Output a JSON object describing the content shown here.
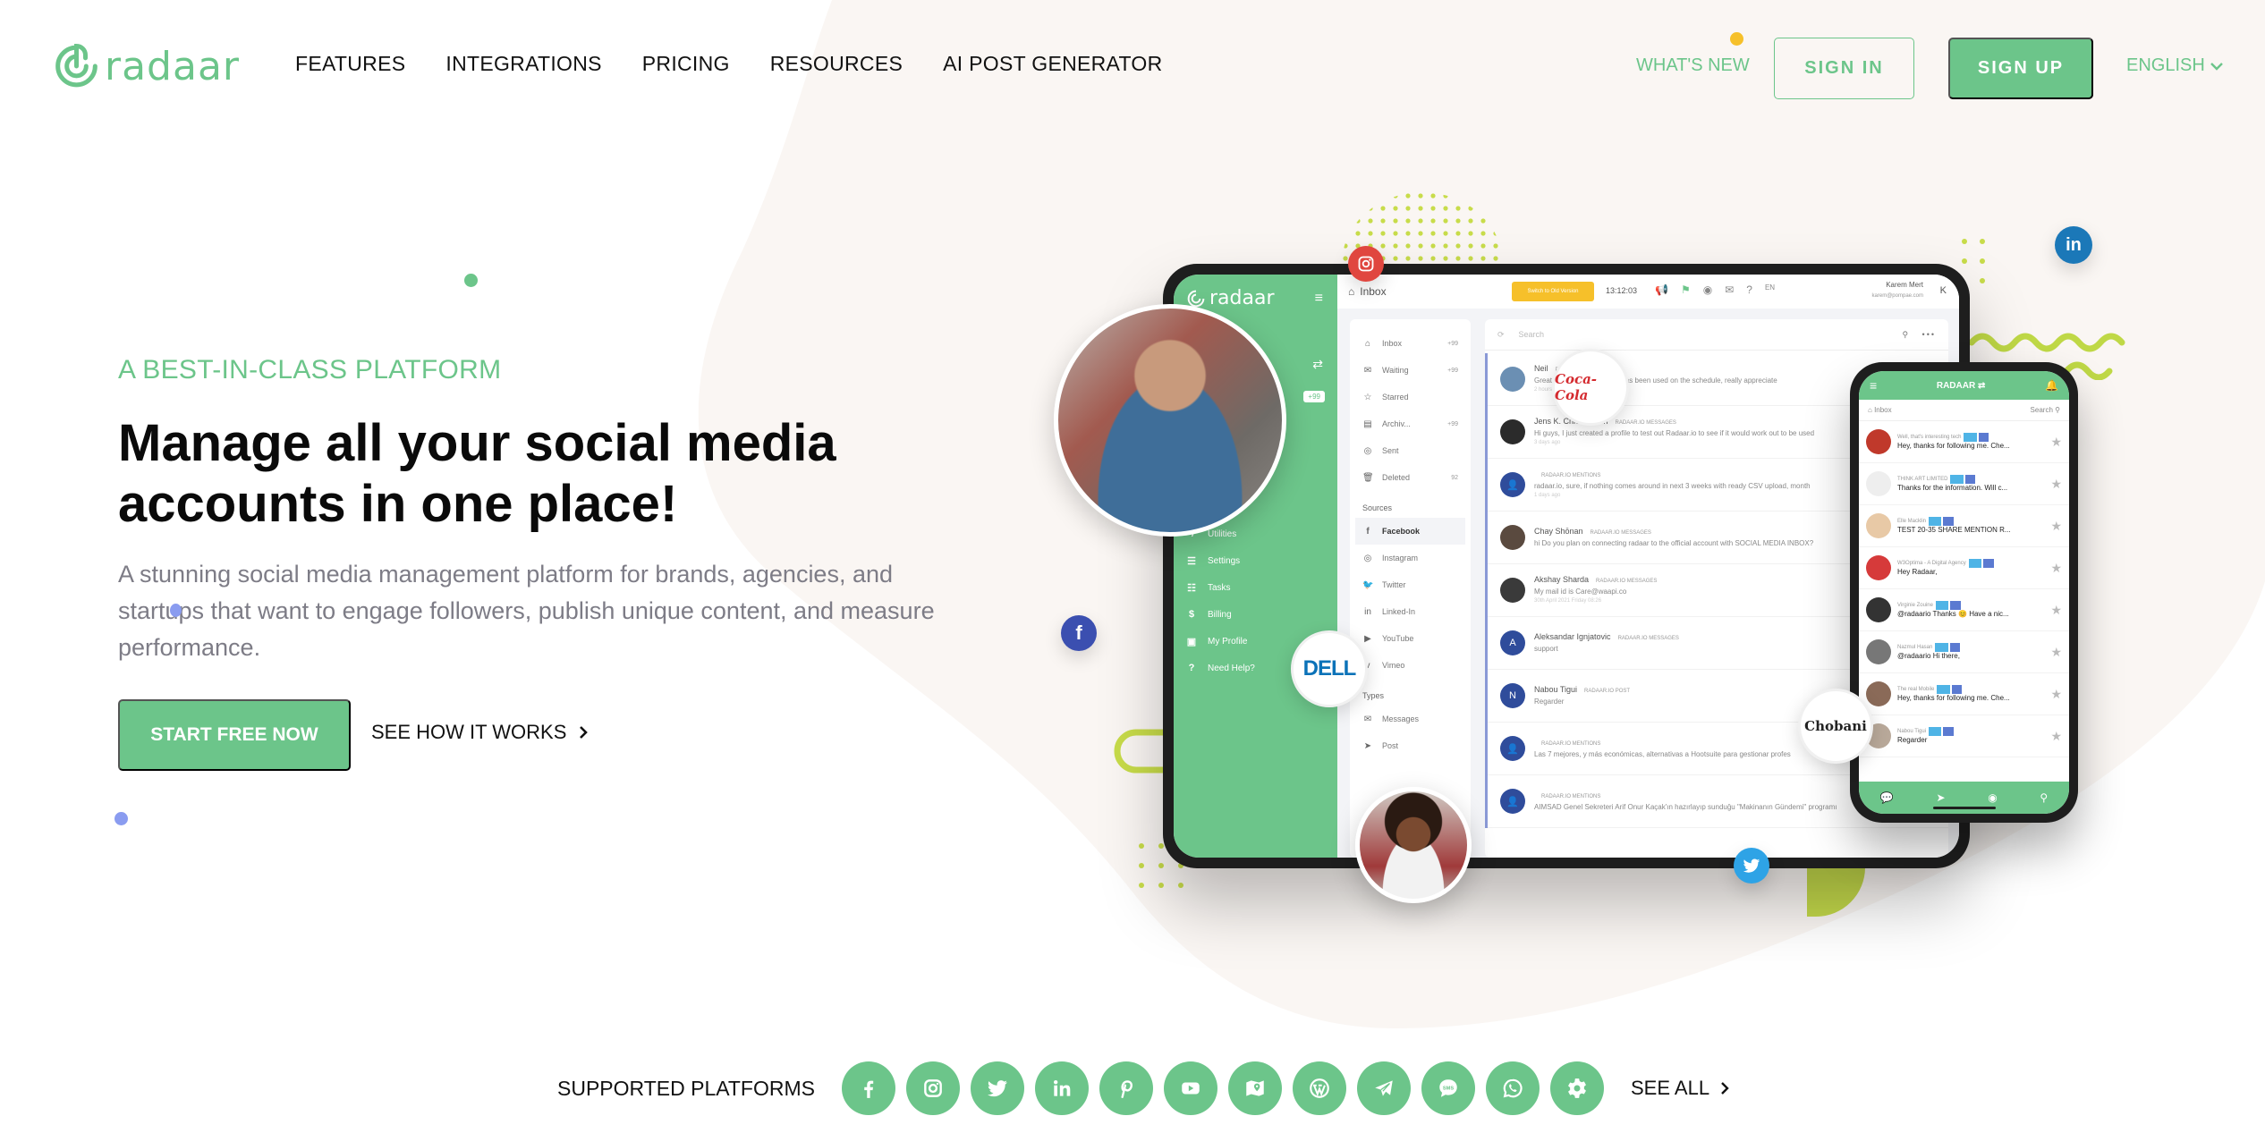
{
  "brand": {
    "name": "radaar",
    "accent": "#6cc58a",
    "notification_dot": "#f6c02a"
  },
  "nav": {
    "items": [
      "FEATURES",
      "INTEGRATIONS",
      "PRICING",
      "RESOURCES",
      "AI POST GENERATOR"
    ],
    "whats_new": "WHAT'S NEW",
    "sign_in": "SIGN IN",
    "sign_up": "SIGN UP",
    "language": "ENGLISH"
  },
  "hero": {
    "tagline": "A BEST-IN-CLASS PLATFORM",
    "headline_line1": "Manage all your social media",
    "headline_line2": "accounts in one place!",
    "subtext": "A stunning social media management platform for brands, agencies, and startups that want to engage followers, publish unique content, and measure performance.",
    "cta_primary": "START FREE NOW",
    "cta_secondary": "SEE HOW IT WORKS"
  },
  "mockup": {
    "app_logo": "radaar",
    "sidebar_badge": "+99",
    "sidebar_items": [
      {
        "icon": "utilities-icon",
        "label": "Utilities"
      },
      {
        "icon": "settings-icon",
        "label": "Settings"
      },
      {
        "icon": "tasks-icon",
        "label": "Tasks"
      },
      {
        "icon": "billing-icon",
        "label": "Billing"
      },
      {
        "icon": "profile-icon",
        "label": "My Profile"
      },
      {
        "icon": "help-icon",
        "label": "Need Help?"
      }
    ],
    "topbar": {
      "page": "Inbox",
      "switch_button": "Switch to Old Version",
      "time": "13:12:03",
      "lang": "EN",
      "user_name": "Karem Mert",
      "user_email": "karem@pompae.com",
      "user_initial": "K"
    },
    "folders": [
      {
        "label": "Inbox",
        "count": "+99"
      },
      {
        "label": "Waiting",
        "count": "+99"
      },
      {
        "label": "Starred",
        "count": ""
      },
      {
        "label": "Archiv...",
        "count": "+99"
      },
      {
        "label": "Sent",
        "count": ""
      },
      {
        "label": "Deleted",
        "count": "92"
      }
    ],
    "sources_title": "Sources",
    "sources": [
      "Facebook",
      "Instagram",
      "Twitter",
      "Linked-In",
      "YouTube",
      "Vimeo"
    ],
    "types_title": "Types",
    "types": [
      "Messages",
      "Post"
    ],
    "search_placeholder": "Search",
    "messages": [
      {
        "name": "Neil",
        "tags": "POST",
        "body": "Great... that social channel has been used on the schedule, really appreciate",
        "time": "2 hours",
        "initial": ""
      },
      {
        "name": "Jens K. Christiansen",
        "tags": "RADAAR.IO  MESSAGES",
        "body": "Hi guys, I just created a profile to test out Radaar.io to see if it would work out to be used",
        "time": "3 days ago",
        "initial": ""
      },
      {
        "name": "",
        "tags": "RADAAR.IO  MENTIONS",
        "body": "radaar.io, sure, if nothing comes around in next 3 weeks with ready CSV upload, month",
        "time": "1 days ago",
        "initial": "user"
      },
      {
        "name": "Chay Shōnan",
        "tags": "RADAAR.IO  MESSAGES",
        "body": "hi Do you plan on connecting radaar to the official account with SOCIAL MEDIA INBOX?",
        "time": "",
        "initial": ""
      },
      {
        "name": "Akshay Sharda",
        "tags": "RADAAR.IO  MESSAGES",
        "body": "My mail id is Care@waapi.co",
        "time": "30th April 2021 Friday 08:26",
        "initial": ""
      },
      {
        "name": "Aleksandar Ignjatovic",
        "tags": "RADAAR.IO  MESSAGES",
        "body": "support",
        "time": "",
        "initial": "A"
      },
      {
        "name": "Nabou Tigui",
        "tags": "RADAAR.IO  POST",
        "body": "Regarder",
        "time": "",
        "initial": "N"
      },
      {
        "name": "",
        "tags": "RADAAR.IO  MENTIONS",
        "body": "Las 7 mejores, y más económicas, alternativas a Hootsuite para gestionar profes",
        "time": "",
        "initial": "user"
      },
      {
        "name": "",
        "tags": "RADAAR.IO  MENTIONS",
        "body": "AIMSAD Genel Sekreteri Arif Onur Kaçak'ın hazırlayıp sunduğu \"Makinanın Gündemi\" programı",
        "time": "",
        "initial": "user"
      }
    ],
    "phone": {
      "title": "RADAAR",
      "inbox": "Inbox",
      "search": "Search",
      "items": [
        {
          "name": "Well, that's interesting tech",
          "msg": "Hey, thanks for following me. Che...",
          "color": "#c0392b"
        },
        {
          "name": "THINK ART LIMITED",
          "msg": "Thanks for the information. Will c...",
          "color": "#eeeeee"
        },
        {
          "name": "Elle Macklin",
          "msg": "TEST 20-35 SHARE MENTION R...",
          "color": "#e8c9a6"
        },
        {
          "name": "W3Optima - A Digital Agency",
          "msg": "Hey Radaar,",
          "color": "#d63a3a"
        },
        {
          "name": "Virginie Zouine",
          "msg": "@radaario Thanks 😊 Have a nic...",
          "color": "#333333"
        },
        {
          "name": "Nazmul Hasan",
          "msg": "@radaario Hi there,",
          "color": "#777777"
        },
        {
          "name": "The real Mobile",
          "msg": "Hey, thanks for following me. Che...",
          "color": "#8a6a58"
        },
        {
          "name": "Nabou Tigui",
          "msg": "Regarder",
          "color": "#b9a99a"
        }
      ]
    },
    "brand_bubbles": [
      "Coca-Cola",
      "DELL",
      "Chobani"
    ]
  },
  "platforms": {
    "label": "SUPPORTED PLATFORMS",
    "icons": [
      "facebook-icon",
      "instagram-icon",
      "twitter-icon",
      "linkedin-icon",
      "pinterest-icon",
      "youtube-icon",
      "google-maps-icon",
      "wordpress-icon",
      "telegram-icon",
      "sms-icon",
      "whatsapp-icon",
      "settings-icon"
    ],
    "see_all": "SEE ALL"
  }
}
